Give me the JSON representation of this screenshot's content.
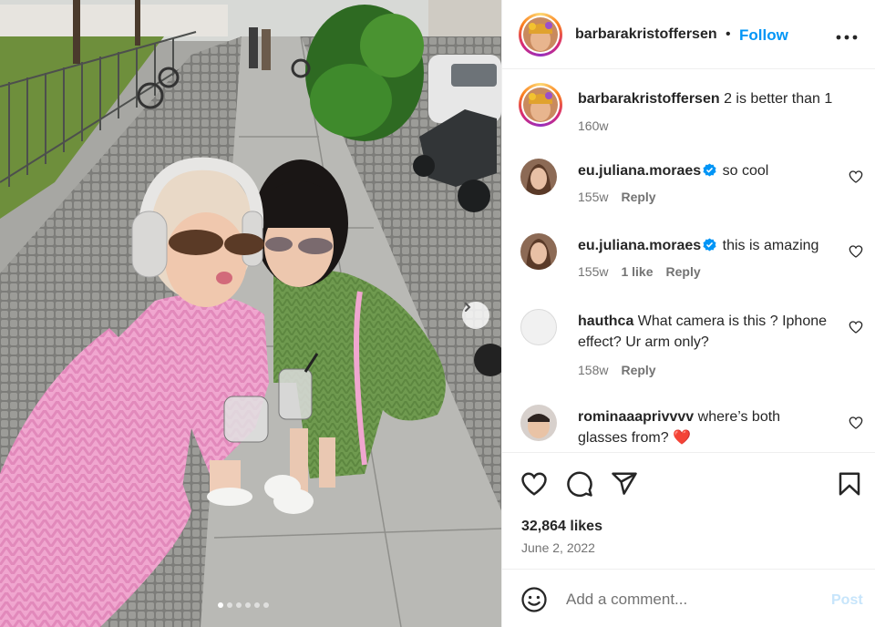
{
  "post": {
    "photo_description_alt": "",
    "carousel": {
      "total_slides": 6,
      "current_slide": 1
    }
  },
  "header": {
    "username": "barbarakristoffersen",
    "separator": "•",
    "follow_label": "Follow",
    "more_icon": "more-horizontal-icon"
  },
  "caption": {
    "username": "barbarakristoffersen",
    "text": "2 is better than 1",
    "time": "160w"
  },
  "comments": [
    {
      "username": "eu.juliana.moraes",
      "verified": true,
      "text": "so cool",
      "time": "155w",
      "likes": "",
      "reply": "Reply"
    },
    {
      "username": "eu.juliana.moraes",
      "verified": true,
      "text": "this is amazing",
      "time": "155w",
      "likes": "1 like",
      "reply": "Reply"
    },
    {
      "username": "hauthca",
      "verified": false,
      "text": "What camera is this ? Iphone effect? Ur arm only?",
      "time": "158w",
      "likes": "",
      "reply": "Reply"
    },
    {
      "username": "rominaaaprivvvv",
      "verified": false,
      "text": "where’s both glasses from?",
      "emoji": "❤️",
      "time": "",
      "likes": "",
      "reply": ""
    }
  ],
  "actions": {
    "likes": "32,864 likes",
    "date": "June 2, 2022",
    "icons": [
      "heart-icon",
      "comment-icon",
      "share-icon",
      "bookmark-icon"
    ]
  },
  "composer": {
    "placeholder": "Add a comment...",
    "post_label": "Post"
  },
  "colors": {
    "accent": "#0095f6",
    "post_disabled": "#c7e5fb",
    "muted": "#737373",
    "text": "#262626",
    "verified": "#0095f6"
  }
}
